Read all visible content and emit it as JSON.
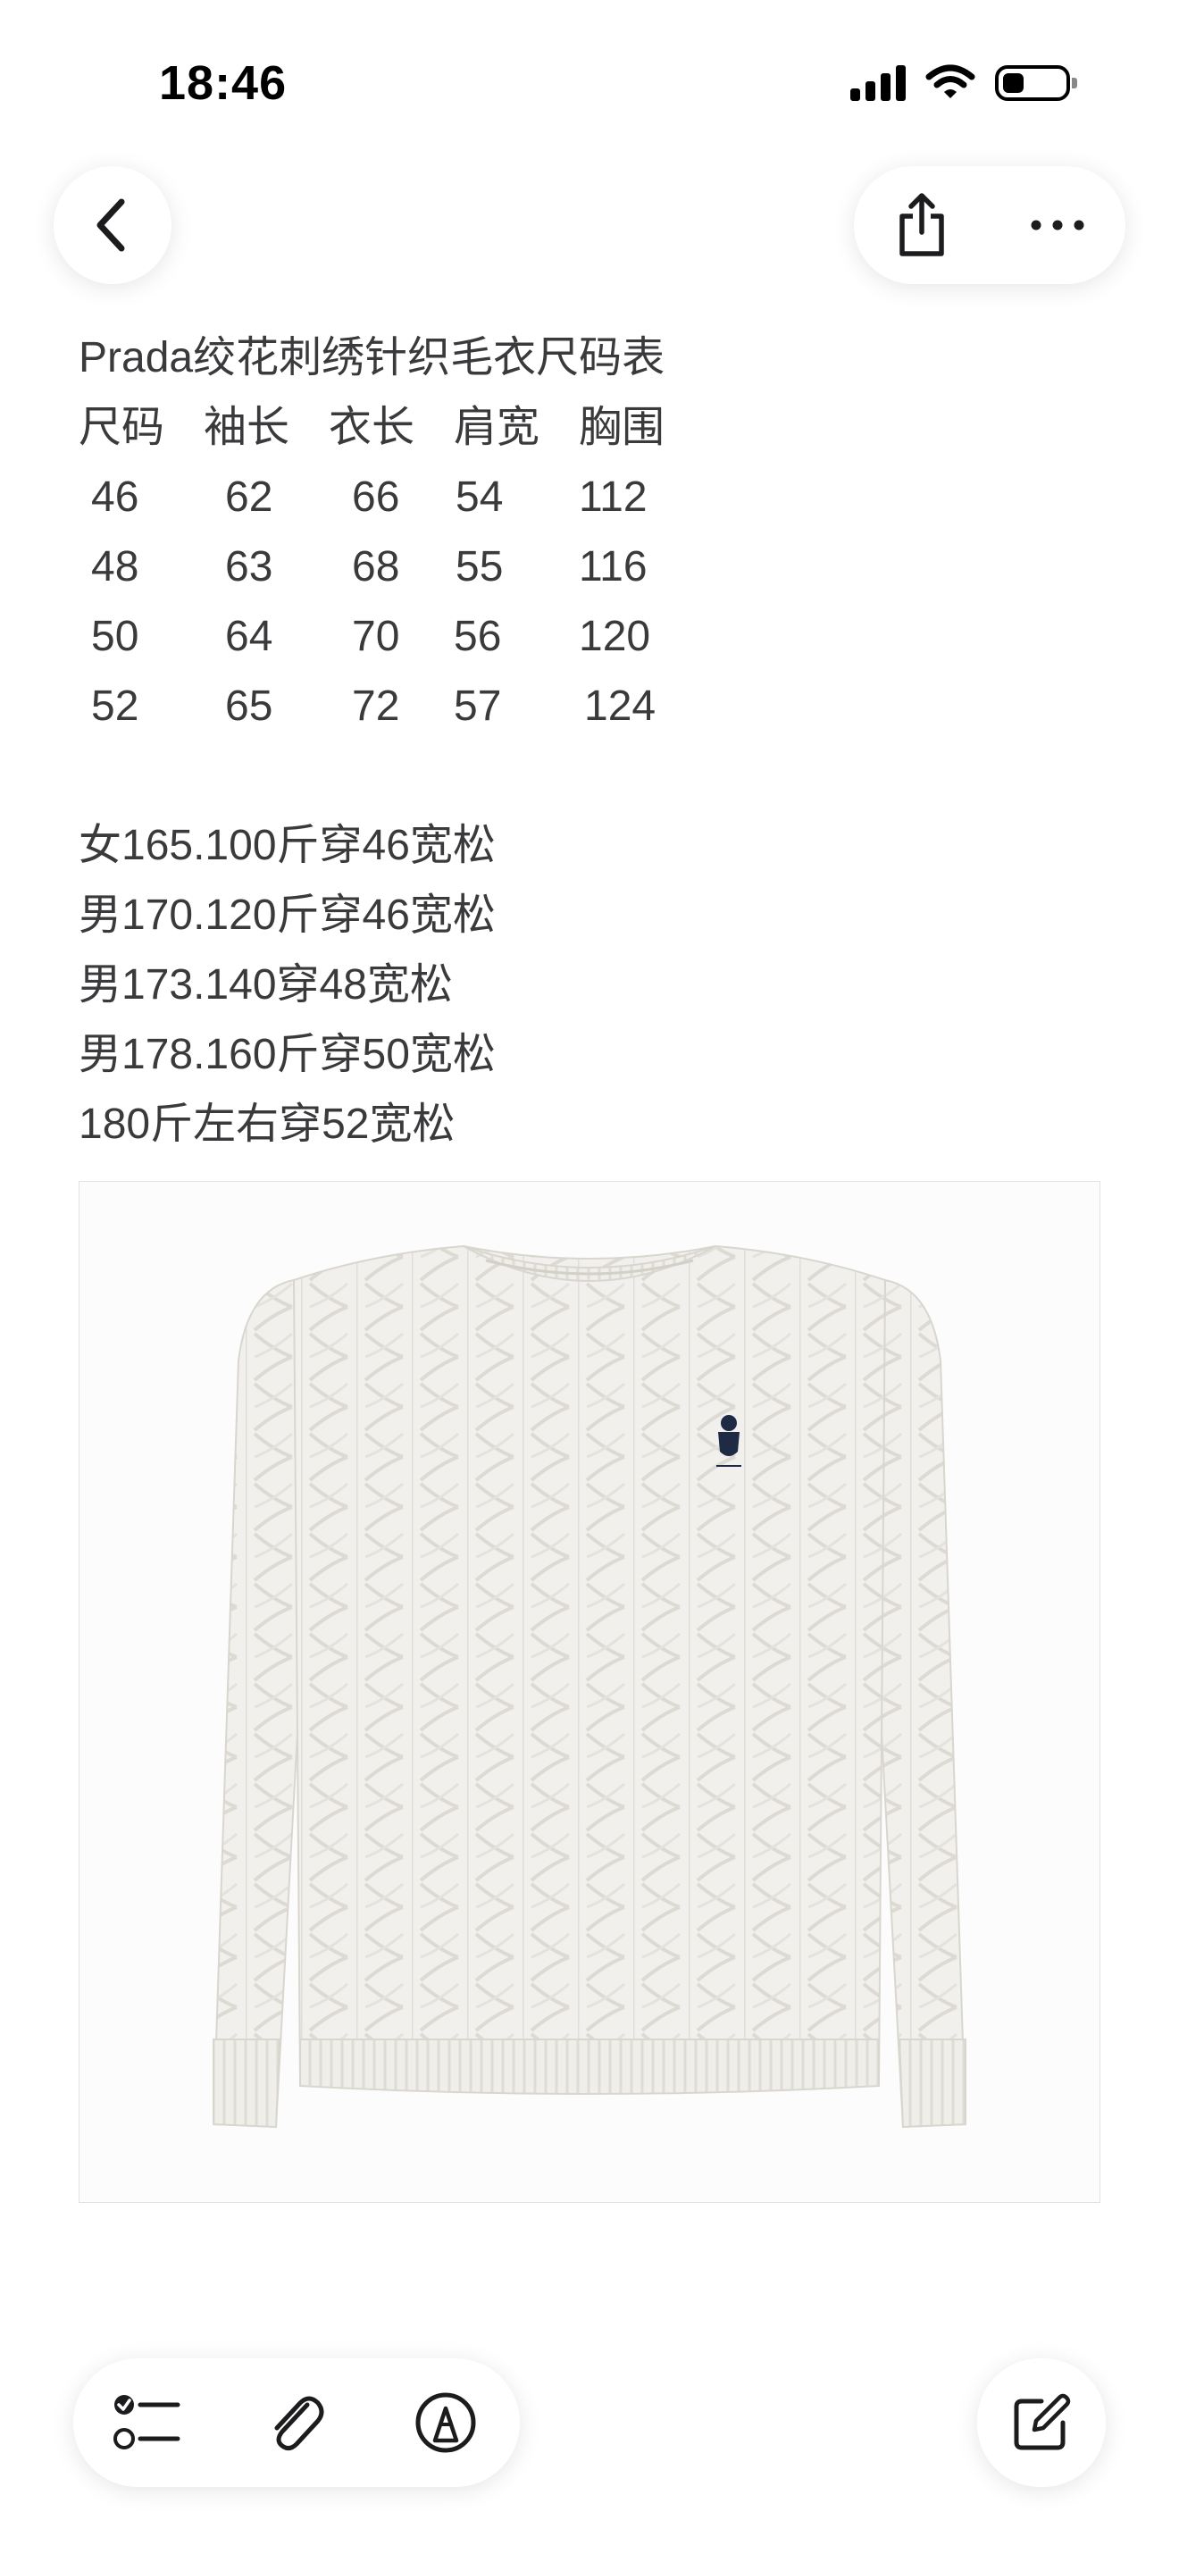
{
  "status_bar": {
    "time": "18:46",
    "battery_level": 0.35
  },
  "note": {
    "title": "Prada绞花刺绣针织毛衣尺码表",
    "table": {
      "headers": [
        "尺码",
        "袖长",
        "衣长",
        "肩宽",
        "胸围"
      ],
      "rows": [
        [
          "46",
          "62",
          "66",
          "54",
          "112"
        ],
        [
          "48",
          "63",
          "68",
          "55",
          "116"
        ],
        [
          "50",
          "64",
          "70",
          "56",
          "120"
        ],
        [
          "52",
          "65",
          "72",
          "57",
          "124"
        ]
      ]
    },
    "fit_lines": [
      "女165.100斤穿46宽松",
      "男170.120斤穿46宽松",
      "男173.140穿48宽松",
      "男178.160斤穿50宽松",
      "180斤左右穿52宽松"
    ]
  },
  "icons": {
    "back": "chevron-left-icon",
    "share": "share-icon",
    "more": "more-icon",
    "checklist": "checklist-icon",
    "attach": "paperclip-icon",
    "markup": "markup-pen-icon",
    "compose": "compose-icon"
  },
  "colors": {
    "icon": "#1c1c1e",
    "text": "#3a3a3c",
    "sweater": "#f1f0ec",
    "emblem": "#1f2a44"
  }
}
